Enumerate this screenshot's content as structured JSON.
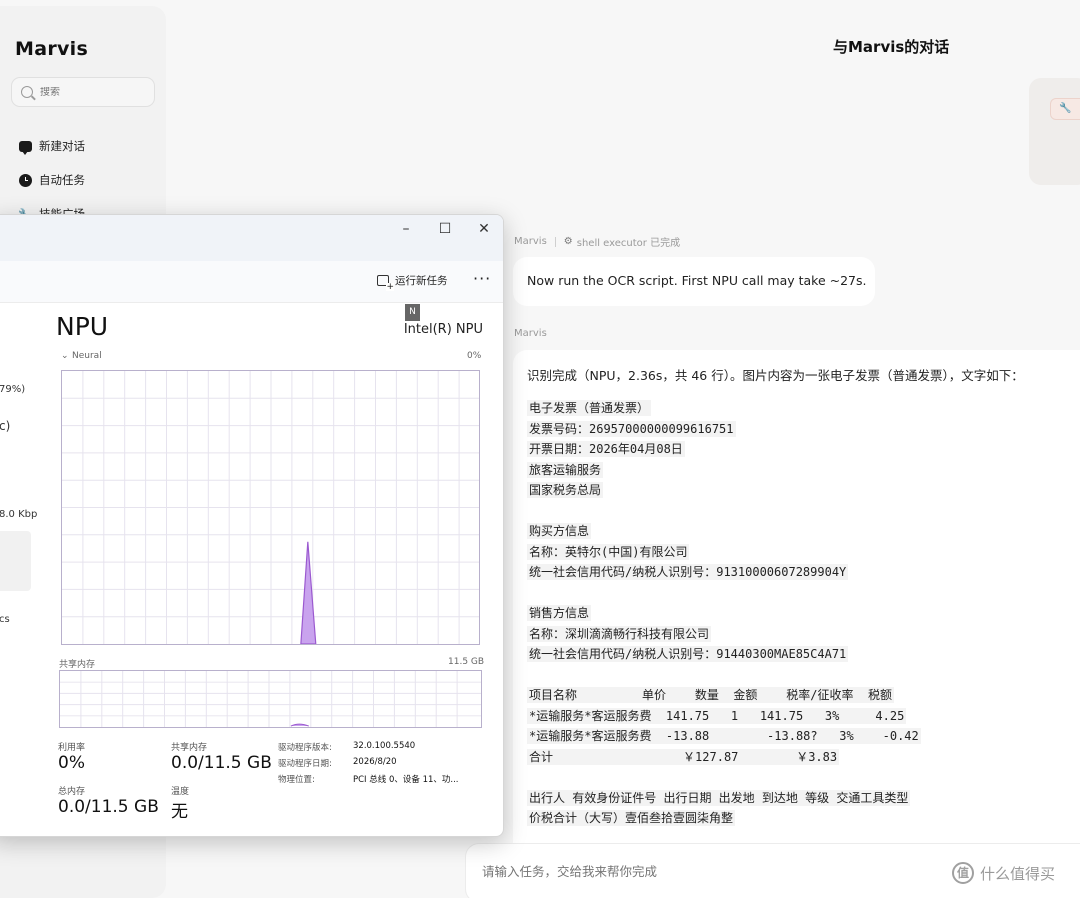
{
  "sidebar": {
    "brand": "Marvis",
    "search_placeholder": "搜索",
    "items": [
      {
        "label": "新建对话"
      },
      {
        "label": "自动任务"
      },
      {
        "label": "技能广场"
      }
    ]
  },
  "header": {
    "title": "与Marvis的对话"
  },
  "messages": [
    {
      "sender": "Marvis",
      "tool": "shell executor 已完成",
      "text": "Now run the OCR script. First NPU call may take ~27s."
    },
    {
      "sender": "Marvis",
      "lead": "识别完成（NPU，2.36s，共 46 行）。图片内容为一张电子发票（普通发票），文字如下：",
      "lines": [
        "电子发票（普通发票）",
        "发票号码：26957000000099616751",
        "开票日期：2026年04月08日",
        "旅客运输服务",
        "国家税务总局",
        "",
        "购买方信息",
        "名称：英特尔(中国)有限公司",
        "统一社会信用代码/纳税人识别号：91310000607289904Y",
        "",
        "销售方信息",
        "名称：深圳滴滴畅行科技有限公司",
        "统一社会信用代码/纳税人识别号：91440300MAE85C4A71",
        "",
        "项目名称         单价    数量  金额    税率/征收率  税额",
        "*运输服务*客运服务费  141.75   1   141.75   3%     4.25",
        "*运输服务*客运服务费  -13.88        -13.88?   3%    -0.42",
        "合计                  ￥127.87        ￥3.83",
        "",
        "出行人 有效身份证件号 出行日期 出发地 到达地 等级 交通工具类型",
        "价税合计（大写）壹佰叁拾壹圆柒角整"
      ]
    }
  ],
  "composer": {
    "placeholder": "请输入任务，交给我来帮你完成"
  },
  "watermark": "什么值得买",
  "task_manager": {
    "controls": {
      "minimize": "–",
      "maximize": "☐",
      "close": "✕"
    },
    "run_new_task": "运行新任务",
    "more": "···",
    "left_fragments": [
      "79%)",
      "c)",
      "8.0 Kbp",
      "cs"
    ],
    "title": "NPU",
    "badge": "N",
    "device_name": "Intel(R) NPU",
    "graph_label": "Neural",
    "graph_max": "0%",
    "shared_mem_label": "共享内存",
    "shared_mem_max": "11.5 GB",
    "stats": [
      {
        "label": "利用率",
        "value": "0%"
      },
      {
        "label": "共享内存",
        "value": "0.0/11.5 GB"
      },
      {
        "label": "总内存",
        "value": "0.0/11.5 GB"
      },
      {
        "label": "温度",
        "value": "无"
      }
    ],
    "info": [
      {
        "label": "驱动程序版本:",
        "value": "32.0.100.5540"
      },
      {
        "label": "驱动程序日期:",
        "value": "2026/8/20"
      },
      {
        "label": "物理位置:",
        "value": "PCI 总线 0、设备 11、功..."
      }
    ]
  },
  "colors": {
    "graph_line": "#9b59d0",
    "graph_fill": "#c9a3ee",
    "grid": "#e6e3ee",
    "accent_chip": "#c06040"
  }
}
